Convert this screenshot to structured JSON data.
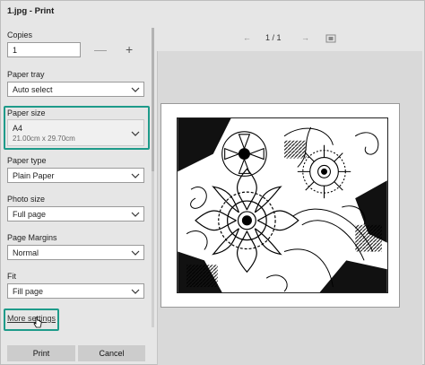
{
  "window": {
    "title": "1.jpg - Print"
  },
  "copies": {
    "label": "Copies",
    "value": "1",
    "minus": "—",
    "plus": "+"
  },
  "paper_tray": {
    "label": "Paper tray",
    "value": "Auto select"
  },
  "paper_size": {
    "label": "Paper size",
    "value": "A4",
    "detail": "21.00cm x 29.70cm"
  },
  "paper_type": {
    "label": "Paper type",
    "value": "Plain Paper"
  },
  "photo_size": {
    "label": "Photo size",
    "value": "Full page"
  },
  "page_margins": {
    "label": "Page Margins",
    "value": "Normal"
  },
  "fit": {
    "label": "Fit",
    "value": "Fill page"
  },
  "more_settings": "More settings",
  "buttons": {
    "print": "Print",
    "cancel": "Cancel"
  },
  "preview": {
    "page_indicator": "1 / 1",
    "prev": "←",
    "next": "→"
  },
  "colors": {
    "highlight": "#1e9b8a"
  },
  "icons": [
    "chevron-down-icon",
    "arrow-left-icon",
    "arrow-right-icon",
    "fit-page-icon",
    "hand-cursor-icon"
  ]
}
